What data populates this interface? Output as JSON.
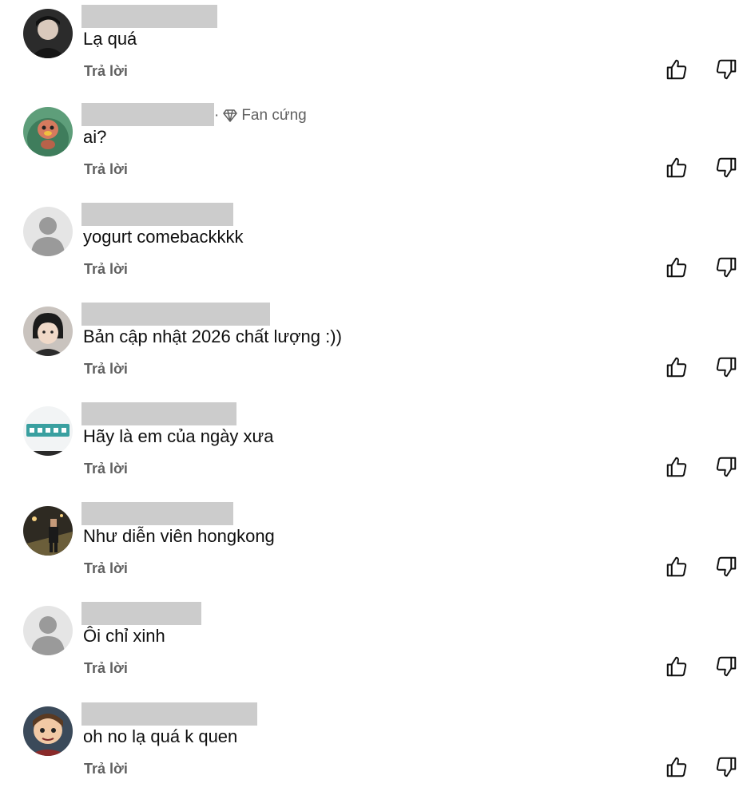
{
  "comments": [
    {
      "text": "Lạ quá",
      "reply_label": "Trả lời",
      "avatar": "avatar-dark-portrait"
    },
    {
      "text": "ai?",
      "reply_label": "Trả lời",
      "badge": "Fan cứng",
      "badge_icon": "diamond-icon",
      "avatar": "avatar-cartoon-green"
    },
    {
      "text": "yogurt comebackkkk",
      "reply_label": "Trả lời",
      "avatar": "avatar-default"
    },
    {
      "text": "Bản cập nhật 2026 chất lượng :))",
      "reply_label": "Trả lời",
      "avatar": "avatar-child-portrait"
    },
    {
      "text": "Hãy là em của ngày xưa",
      "reply_label": "Trả lời",
      "avatar": "avatar-router-device"
    },
    {
      "text": "Như diễn viên hongkong",
      "reply_label": "Trả lời",
      "avatar": "avatar-street-night"
    },
    {
      "text": "Ôi chỉ xinh",
      "reply_label": "Trả lời",
      "avatar": "avatar-default"
    },
    {
      "text": "oh no lạ quá k quen",
      "reply_label": "Trả lời",
      "avatar": "avatar-cartoon-character"
    }
  ],
  "icons": {
    "like": "thumbs-up-icon",
    "dislike": "thumbs-down-icon"
  },
  "colors": {
    "text_primary": "#0f0f0f",
    "text_secondary": "#606060",
    "redaction": "#cccccc",
    "default_avatar_bg": "#e5e5e5",
    "default_avatar_fg": "#9a9a9a"
  }
}
